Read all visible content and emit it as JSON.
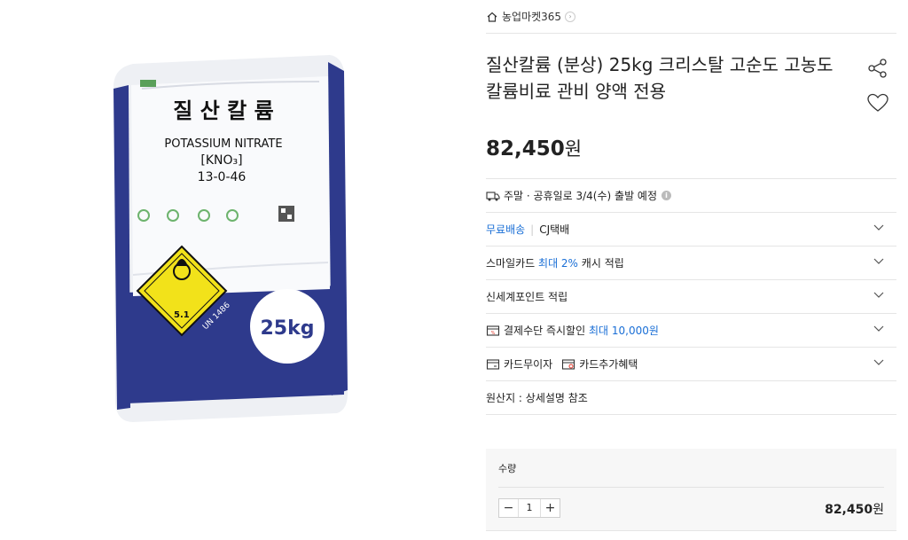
{
  "breadcrumb": {
    "store": "농업마켓365"
  },
  "product": {
    "title": "질산칼륨 (분상) 25kg 크리스탈 고순도 고농도 칼륨비료 관비 양액 전용",
    "price": "82,450",
    "currency": "원"
  },
  "bag": {
    "ko_name": "질 산 칼 륨",
    "en_name": "POTASSIUM NITRATE",
    "formula": "[KNO₃]",
    "npk": "13-0-46",
    "hazard_class": "5.1",
    "un_code": "UN 1486",
    "weight": "25kg"
  },
  "shipping": {
    "schedule": "주말 · 공휴일로 3/4(수) 출발 예정",
    "free_label": "무료배송",
    "carrier": "CJ택배"
  },
  "benefits": {
    "smile_prefix": "스마일카드",
    "smile_highlight": "최대 2%",
    "smile_suffix": "캐시 적립",
    "ssg_points": "신세계포인트 적립",
    "pay_discount_prefix": "결제수단 즉시할인",
    "pay_discount_highlight": "최대 10,000원",
    "card_installment": "카드무이자",
    "card_extra": "카드추가혜택",
    "origin": "원산지 : 상세설명 참조"
  },
  "quantity": {
    "label": "수량",
    "value": "1",
    "minus": "−",
    "plus": "+",
    "total": "82,450",
    "currency": "원"
  },
  "colors": {
    "accent_blue": "#1a6fd6",
    "bag_navy": "#2e3a8c",
    "hazard_yellow": "#f2e21a"
  }
}
